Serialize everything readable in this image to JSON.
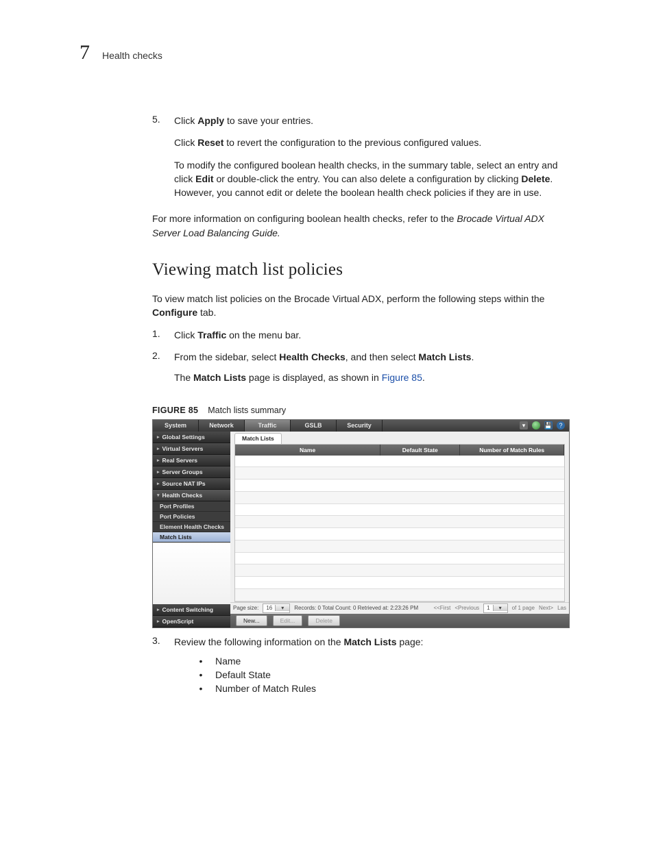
{
  "header": {
    "chapter_number": "7",
    "section_title": "Health checks"
  },
  "body": {
    "step5_num": "5.",
    "step5_a_pre": "Click ",
    "step5_a_bold": "Apply",
    "step5_a_post": " to save your entries.",
    "step5_b_pre": "Click ",
    "step5_b_bold": "Reset",
    "step5_b_post": " to revert the configuration to the previous configured values.",
    "step5_c_1": "To modify the configured boolean health checks, in the summary table, select an entry and click ",
    "step5_c_b1": "Edit",
    "step5_c_2": " or double-click the entry. You can also delete a configuration by clicking ",
    "step5_c_b2": "Delete",
    "step5_c_3": ". However, you cannot edit or delete the boolean health check policies if they are in use.",
    "more_info_pre": "For more information on configuring boolean health checks, refer to the ",
    "more_info_ital": "Brocade Virtual ADX Server Load Balancing Guide.",
    "heading": "Viewing match list policies",
    "intro_pre": "To view match list policies on the Brocade Virtual ADX, perform the following steps within the ",
    "intro_bold": "Configure",
    "intro_post": " tab.",
    "s1_num": "1.",
    "s1_pre": "Click ",
    "s1_bold": "Traffic",
    "s1_post": " on the menu bar.",
    "s2_num": "2.",
    "s2_pre": "From the sidebar, select ",
    "s2_b1": "Health Checks",
    "s2_mid": ", and then select ",
    "s2_b2": "Match Lists",
    "s2_post": ".",
    "s2_sub_pre": "The ",
    "s2_sub_b": "Match Lists",
    "s2_sub_mid": " page is displayed, as shown in ",
    "s2_sub_link": "Figure 85",
    "s2_sub_post": ".",
    "fig_label": "FIGURE 85",
    "fig_title": "Match lists summary",
    "s3_num": "3.",
    "s3_pre": "Review the following information on the ",
    "s3_b": "Match Lists",
    "s3_post": " page:",
    "bullets": {
      "b1": "Name",
      "b2": "Default State",
      "b3": "Number of Match Rules"
    }
  },
  "screenshot": {
    "top_tabs": {
      "t0": "System",
      "t1": "Network",
      "t2": "Traffic",
      "t3": "GSLB",
      "t4": "Security"
    },
    "sidebar": {
      "global_settings": "Global Settings",
      "virtual_servers": "Virtual Servers",
      "real_servers": "Real Servers",
      "server_groups": "Server Groups",
      "source_nat_ips": "Source NAT IPs",
      "health_checks": "Health Checks",
      "port_profiles": "Port Profiles",
      "port_policies": "Port Policies",
      "element_hc": "Element Health Checks",
      "match_lists": "Match Lists",
      "content_switching": "Content Switching",
      "open_script": "OpenScript"
    },
    "breadcrumb_tab": "Match Lists",
    "columns": {
      "name": "Name",
      "default_state": "Default State",
      "num_rules": "Number of Match Rules"
    },
    "pager": {
      "page_size_label": "Page size:",
      "page_size_value": "16",
      "status": "Records: 0  Total Count: 0  Retrieved at: 2:23:26 PM",
      "first": "<<First",
      "prev": "<Previous",
      "page_value": "1",
      "of_pages": "of 1 page",
      "next": "Next>",
      "last": "Las"
    },
    "buttons": {
      "new": "New...",
      "edit": "Edit...",
      "delete": "Delete"
    }
  }
}
